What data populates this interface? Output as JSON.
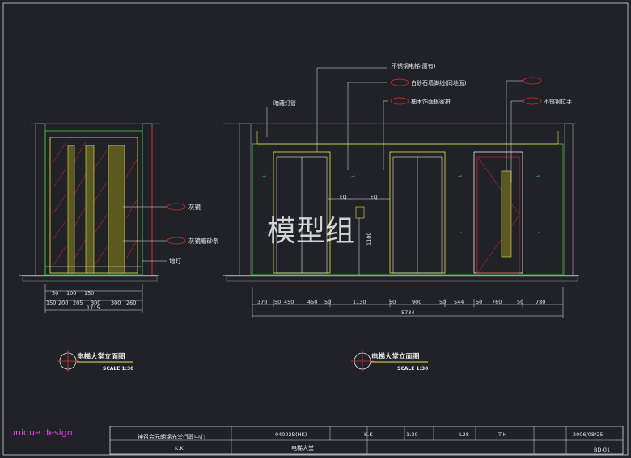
{
  "watermark": "模型组",
  "brand": "unique design",
  "left_view": {
    "labels": {
      "mirror": "灰镜",
      "mirror_strip": "灰镜磨砂条",
      "floor_light": "地灯"
    },
    "dims_top": [
      "50",
      "100",
      "150"
    ],
    "dims_mid": [
      "150",
      "200",
      "205",
      "300",
      "300",
      "260"
    ],
    "dim_total": "1715",
    "title": "电梯大堂立面图",
    "scale": "SCALE 1:30"
  },
  "right_view": {
    "labels": {
      "light_trough": "暗藏灯管",
      "door_frame": "不锈钢电梯(原有)",
      "stone_wall": "白砂石墙脚线(同地面)",
      "wood_panel": "柚木饰面板密拼",
      "handle_tag": "",
      "handle": "不锈钢拉手"
    },
    "eq": [
      "EQ",
      "EQ"
    ],
    "height_dim": "1100",
    "dims": [
      "370",
      "50",
      "450",
      "450",
      "50",
      "1130",
      "50",
      "900",
      "50",
      "544",
      "50",
      "760",
      "50",
      "780"
    ],
    "dim_total": "5734",
    "title": "电梯大堂立面图",
    "scale": "SCALE 1:30"
  },
  "title_block": {
    "project_name": "神召会元朗锦光堂行政中心",
    "project_no": "04002B(HK)",
    "designer": "K.K",
    "scale": "1:30",
    "sheet": "L28",
    "rev": "T-H",
    "date": "2006/08/25",
    "drawing_name": "电梯大堂",
    "drawing_no": "BD-01",
    "checker": "K.K"
  }
}
